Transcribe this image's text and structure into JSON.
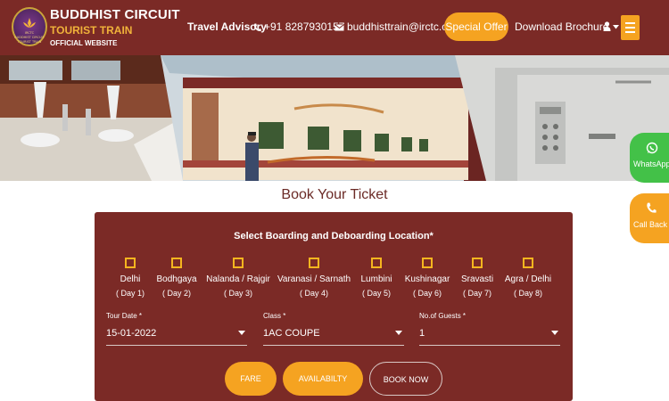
{
  "header": {
    "brand_line1": "BUDDHIST CIRCUIT",
    "brand_line2": "TOURIST TRAIN",
    "brand_line3": "OFFICIAL WEBSITE",
    "logo_text_top": "IRCTC",
    "logo_text_mid": "BUDDHIST CIRCUIT",
    "logo_text_bot": "TOURIST TRAIN",
    "travel_advisory": "Travel Advisory",
    "phone": "+91 8287930157",
    "email": "buddhisttrain@irctc.com",
    "special_offer": "Special Offer",
    "download_brochure": "Download Brochure"
  },
  "floating": {
    "whatsapp": "WhatsApp",
    "callback": "Call Back"
  },
  "booking": {
    "title": "Book Your Ticket",
    "heading": "Select Boarding and Deboarding Location*",
    "stops": [
      {
        "name": "Delhi",
        "day": "( Day 1)"
      },
      {
        "name": "Bodhgaya",
        "day": "( Day 2)"
      },
      {
        "name": "Nalanda / Rajgir",
        "day": "( Day 3)"
      },
      {
        "name": "Varanasi / Sarnath",
        "day": "( Day 4)"
      },
      {
        "name": "Lumbini",
        "day": "( Day 5)"
      },
      {
        "name": "Kushinagar",
        "day": "( Day 6)"
      },
      {
        "name": "Sravasti",
        "day": "( Day 7)"
      },
      {
        "name": "Agra / Delhi",
        "day": "( Day 8)"
      }
    ],
    "tour_date_label": "Tour Date *",
    "tour_date_value": "15-01-2022",
    "class_label": "Class *",
    "class_value": "1AC COUPE",
    "guests_label": "No.of Guests *",
    "guests_value": "1",
    "fare_button": "FARE",
    "availability_button": "AVAILABILTY",
    "book_now_button": "BOOK NOW"
  },
  "colors": {
    "header_bg": "#7b2a26",
    "accent_orange": "#f5a321",
    "whatsapp_green": "#43c148",
    "checkbox_border": "#f5b51f"
  }
}
